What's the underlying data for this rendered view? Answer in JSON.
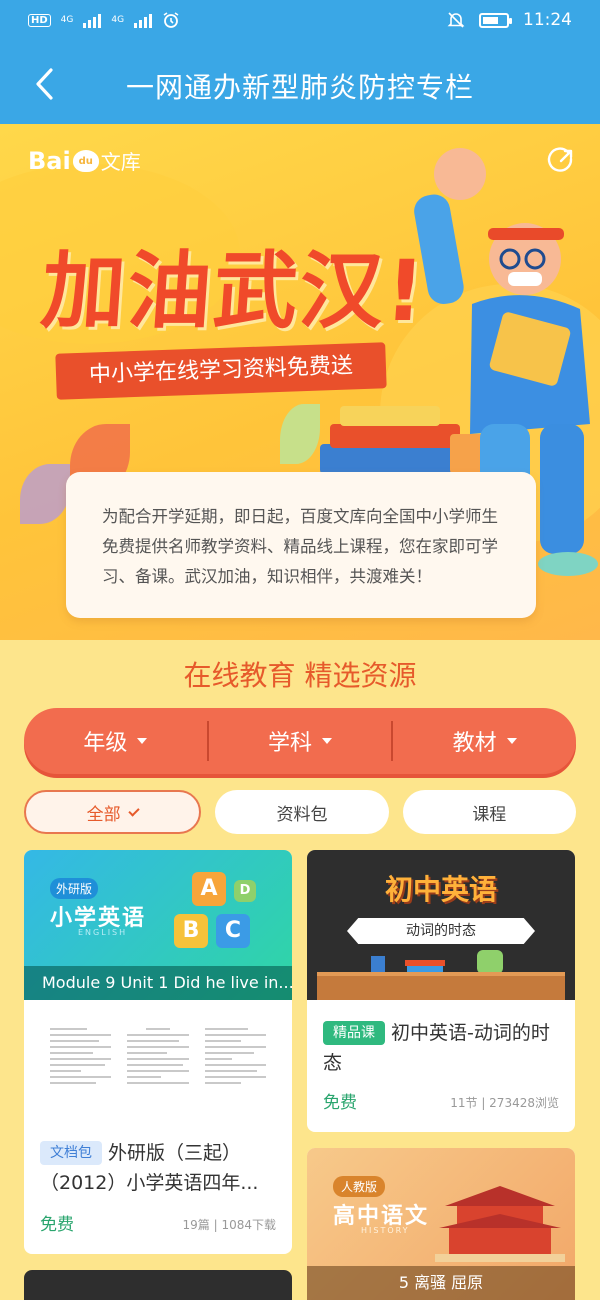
{
  "status_bar": {
    "hd": "HD",
    "net1": "4G",
    "net2": "4G",
    "time": "11:24",
    "battery_level": 0.7,
    "icons": [
      "hd-icon",
      "signal-icon",
      "signal-icon",
      "alarm-icon",
      "mute-icon",
      "battery-icon"
    ]
  },
  "nav": {
    "title": "一网通办新型肺炎防控专栏",
    "back_icon": "chevron-left-icon"
  },
  "banner": {
    "logo_bai": "Bai",
    "logo_du": "du",
    "logo_wenku": "文库",
    "headline": "加油武汉!",
    "ribbon": "中小学在线学习资料免费送",
    "note": "为配合开学延期，即日起，百度文库向全国中小学师生免费提供名师教学资料、精品线上课程，您在家即可学习、备课。武汉加油，知识相伴，共渡难关！",
    "share_icon": "share-icon"
  },
  "section_title": "在线教育 精选资源",
  "filters": [
    {
      "label": "年级"
    },
    {
      "label": "学科"
    },
    {
      "label": "教材"
    }
  ],
  "tabs": [
    {
      "label": "全部",
      "active": true
    },
    {
      "label": "资料包",
      "active": false
    },
    {
      "label": "课程",
      "active": false
    }
  ],
  "cards": {
    "c1": {
      "publisher": "外研版",
      "cover_title": "小学英语",
      "cover_sub": "ENGLISH",
      "blocks": [
        "A",
        "D",
        "B",
        "C"
      ],
      "strip": "Module 9 Unit 1 Did he live in...",
      "badge": "文档包",
      "name": "外研版（三起）（2012）小学英语四年...",
      "price": "免费",
      "meta": "19篇 | 1084下载"
    },
    "c2": {
      "cover_title": "初中英语",
      "cover_sub": "动词的时态",
      "badge": "精品课",
      "name": "初中英语-动词的时态",
      "price": "免费",
      "meta": "11节 | 273428浏览"
    },
    "c3": {
      "publisher": "人教版",
      "cover_title": "高中语文",
      "cover_sub": "HISTORY",
      "strip": "5 离骚 屈原"
    }
  }
}
